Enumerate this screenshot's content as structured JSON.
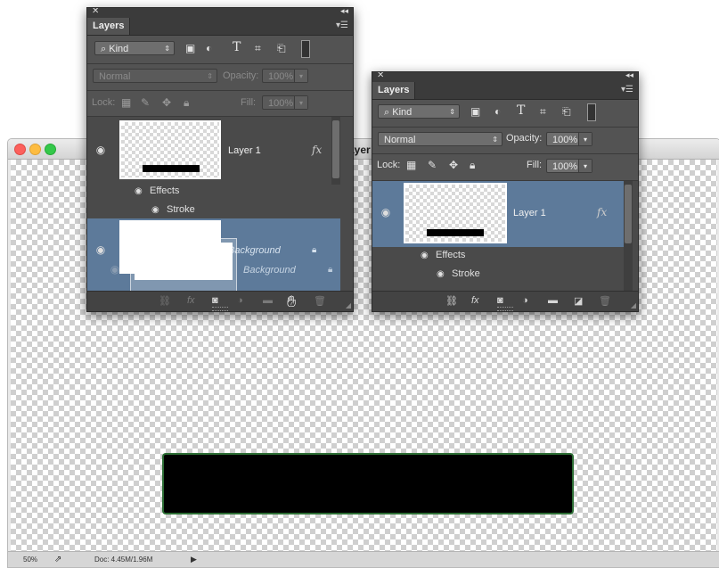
{
  "document": {
    "title_fragment": "ayer",
    "status": {
      "zoom": "50%",
      "doc_info": "Doc: 4.45M/1.96M"
    }
  },
  "panel_left": {
    "tab": "Layers",
    "filter_label": "Kind",
    "blend_mode": "Normal",
    "opacity_label": "Opacity:",
    "opacity_value": "100%",
    "lock_label": "Lock:",
    "fill_label": "Fill:",
    "fill_value": "100%",
    "layers": {
      "layer1_name": "Layer 1",
      "fx_label": "fx",
      "effects_label": "Effects",
      "stroke_label": "Stroke",
      "background_name": "Background",
      "background_ghost_name": "Background"
    }
  },
  "panel_right": {
    "tab": "Layers",
    "filter_label": "Kind",
    "blend_mode": "Normal",
    "opacity_label": "Opacity:",
    "opacity_value": "100%",
    "lock_label": "Lock:",
    "fill_label": "Fill:",
    "fill_value": "100%",
    "layers": {
      "layer1_name": "Layer 1",
      "fx_label": "fx",
      "effects_label": "Effects",
      "stroke_label": "Stroke"
    }
  },
  "colors": {
    "panel_bg": "#535353",
    "selected_row": "#5d7a9a",
    "stroke_green": "#2d6e35"
  },
  "icons": {
    "filter_types": [
      "pixel-image-icon",
      "adjustment-icon",
      "type-icon",
      "shape-icon",
      "smart-object-icon",
      "filter-toggle-icon"
    ],
    "locks": [
      "lock-transparent-icon",
      "lock-brush-icon",
      "lock-move-icon",
      "lock-all-icon"
    ],
    "bottom": [
      "link-icon",
      "fx-icon",
      "mask-icon",
      "adjustment-layer-icon",
      "new-group-icon",
      "new-layer-icon",
      "trash-icon"
    ]
  }
}
